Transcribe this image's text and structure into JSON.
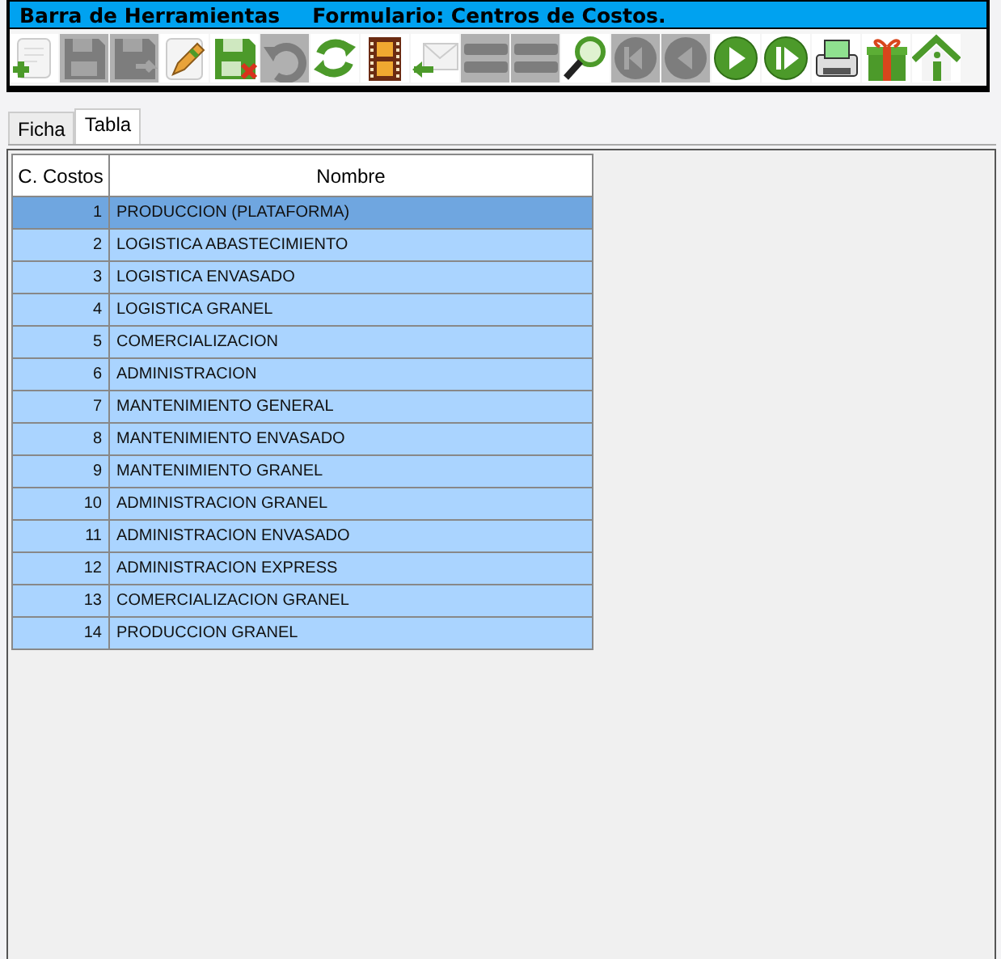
{
  "window": {
    "title": "Barra de Herramientas",
    "subtitle": "Formulario: Centros de Costos."
  },
  "toolbar": [
    {
      "kind": "add",
      "disabled": false
    },
    {
      "kind": "save",
      "disabled": true
    },
    {
      "kind": "saveas",
      "disabled": true
    },
    {
      "kind": "edit",
      "disabled": false
    },
    {
      "kind": "savecancel",
      "disabled": false
    },
    {
      "kind": "undo",
      "disabled": true
    },
    {
      "kind": "refresh",
      "disabled": false
    },
    {
      "kind": "film",
      "disabled": false
    },
    {
      "kind": "mail",
      "disabled": false
    },
    {
      "kind": "list",
      "disabled": true
    },
    {
      "kind": "list",
      "disabled": true
    },
    {
      "kind": "search",
      "disabled": false
    },
    {
      "kind": "first",
      "disabled": true
    },
    {
      "kind": "prev",
      "disabled": true
    },
    {
      "kind": "next",
      "disabled": false
    },
    {
      "kind": "last",
      "disabled": false
    },
    {
      "kind": "printer",
      "disabled": false
    },
    {
      "kind": "gift",
      "disabled": false
    },
    {
      "kind": "home",
      "disabled": false
    }
  ],
  "tabs": [
    {
      "label": "Ficha",
      "selected": false
    },
    {
      "label": "Tabla",
      "selected": true
    }
  ],
  "table": {
    "columns": [
      "C. Costos",
      "Nombre"
    ],
    "rows": [
      {
        "cells": [
          "1",
          "PRODUCCION (PLATAFORMA)"
        ],
        "selected": true
      },
      {
        "cells": [
          "2",
          "LOGISTICA ABASTECIMIENTO"
        ],
        "selected": false
      },
      {
        "cells": [
          "3",
          "LOGISTICA ENVASADO"
        ],
        "selected": false
      },
      {
        "cells": [
          "4",
          "LOGISTICA GRANEL"
        ],
        "selected": false
      },
      {
        "cells": [
          "5",
          "COMERCIALIZACION"
        ],
        "selected": false
      },
      {
        "cells": [
          "6",
          "ADMINISTRACION"
        ],
        "selected": false
      },
      {
        "cells": [
          "7",
          "MANTENIMIENTO GENERAL"
        ],
        "selected": false
      },
      {
        "cells": [
          "8",
          "MANTENIMIENTO ENVASADO"
        ],
        "selected": false
      },
      {
        "cells": [
          "9",
          "MANTENIMIENTO GRANEL"
        ],
        "selected": false
      },
      {
        "cells": [
          "10",
          "ADMINISTRACION GRANEL"
        ],
        "selected": false
      },
      {
        "cells": [
          "11",
          "ADMINISTRACION ENVASADO"
        ],
        "selected": false
      },
      {
        "cells": [
          "12",
          "ADMINISTRACION EXPRESS"
        ],
        "selected": false
      },
      {
        "cells": [
          "13",
          "COMERCIALIZACION GRANEL"
        ],
        "selected": false
      },
      {
        "cells": [
          "14",
          "PRODUCCION GRANEL"
        ],
        "selected": false
      }
    ]
  }
}
